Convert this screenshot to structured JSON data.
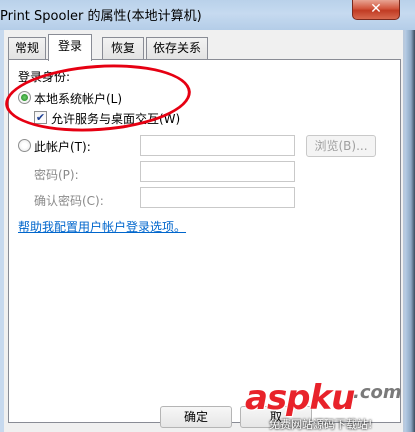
{
  "window": {
    "title": "Print Spooler 的属性(本地计算机)",
    "close_label": "✕"
  },
  "tabs": [
    {
      "label": "常规",
      "active": false
    },
    {
      "label": "登录",
      "active": true
    },
    {
      "label": "恢复",
      "active": false
    },
    {
      "label": "依存关系",
      "active": false
    }
  ],
  "logon": {
    "section_label": "登录身份:",
    "local_system_label": "本地系统帐户(L)",
    "local_system_selected": true,
    "interact_label": "允许服务与桌面交互(W)",
    "interact_checked": true,
    "this_account_label": "此帐户(T):",
    "this_account_selected": false,
    "account_value": "",
    "browse_label": "浏览(B)...",
    "password_label": "密码(P):",
    "password_value": "",
    "confirm_label": "确认密码(C):",
    "confirm_value": "",
    "help_link": "帮助我配置用户帐户登录选项。"
  },
  "footer": {
    "ok_label": "确定",
    "cancel_label": "取"
  },
  "watermark": {
    "brand": "aspku",
    "tld": ".com",
    "tagline": "免费网站源码下载站!"
  },
  "colors": {
    "annotation_oval": "#e60012",
    "link": "#0066cc"
  }
}
